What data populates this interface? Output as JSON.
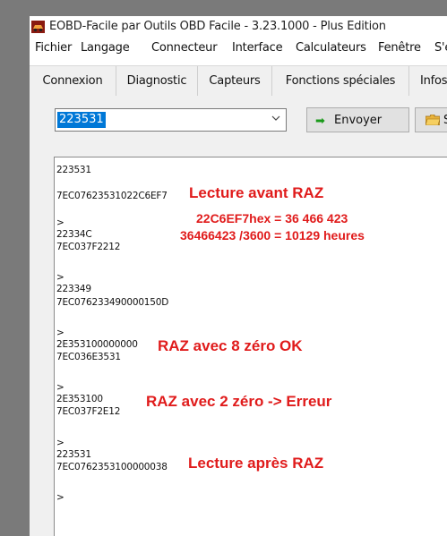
{
  "window": {
    "title": "EOBD-Facile par Outils OBD Facile - 3.23.1000 - Plus Edition"
  },
  "menu": [
    "Fichier",
    "Langage",
    "Connecteur",
    "Interface",
    "Calculateurs",
    "Fenêtre",
    "S'e"
  ],
  "tabs": [
    "Connexion",
    "Diagnostic",
    "Capteurs",
    "Fonctions spéciales",
    "Infos"
  ],
  "command": {
    "value": "223531",
    "send_label": "Envoyer",
    "other_label": "Sa"
  },
  "console": {
    "lines": [
      "223531",
      "7EC07623531022C6EF7",
      ">",
      "22334C",
      "7EC037F2212",
      ">",
      "223349",
      "7EC076233490000150D",
      ">",
      "2E353100000000",
      "7EC036E3531",
      ">",
      "2E353100",
      "7EC037F2E12",
      ">",
      "223531",
      "7EC0762353100000038",
      ">"
    ]
  },
  "annotations": {
    "before_reset": "Lecture avant RAZ",
    "hex_value": "22C6EF7hex = 36 466 423",
    "hours": "36466423 /3600 = 10129 heures",
    "reset_ok": "RAZ avec 8 zéro OK",
    "reset_error": "RAZ avec 2 zéro -> Erreur",
    "after_reset": "Lecture après RAZ"
  },
  "colors": {
    "accent": "#e01b1b",
    "selection": "#0078d7",
    "send_icon": "#1a9a1a"
  },
  "icons": {
    "app": "car-app-icon",
    "send": "right-arrow-icon",
    "other": "folder-icon",
    "dropdown": "chevron-down-icon"
  }
}
